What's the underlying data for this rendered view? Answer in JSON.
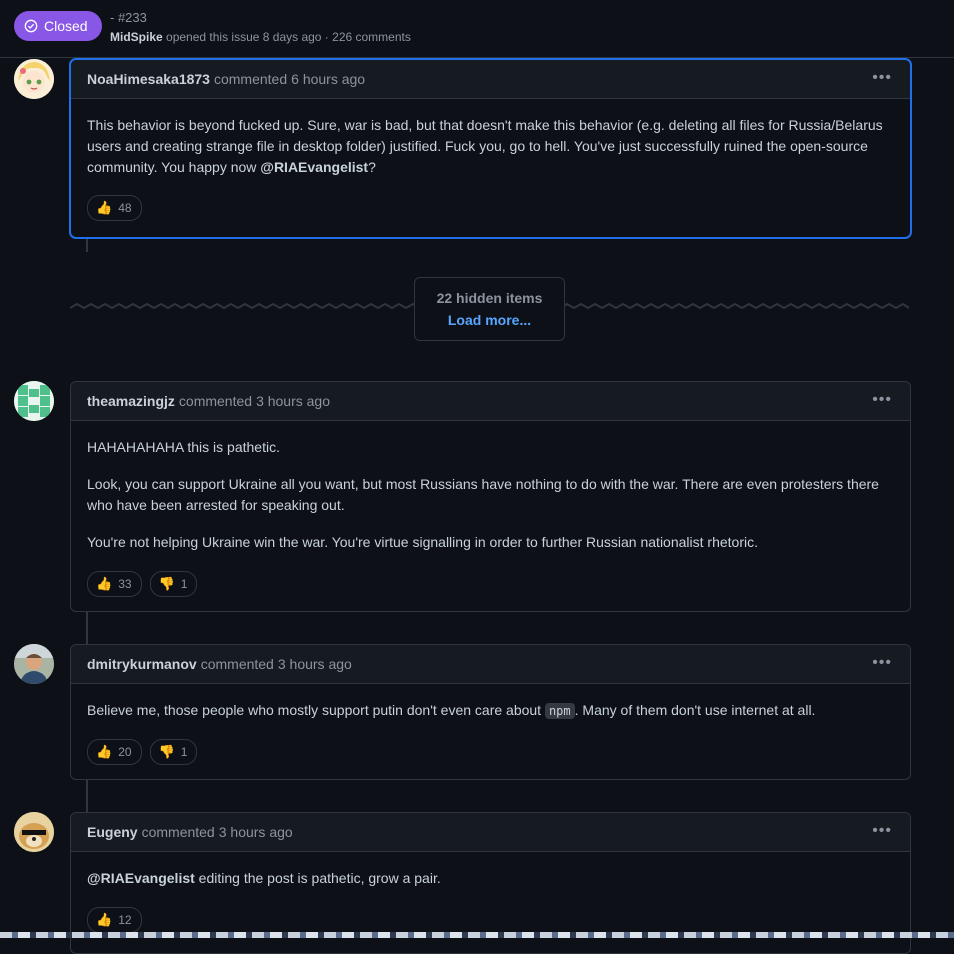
{
  "header": {
    "status_label": "Closed",
    "issue_number": "- #233",
    "author": "MidSpike",
    "meta_text": "opened this issue 8 days ago · 226 comments"
  },
  "comments": [
    {
      "author": "NoaHimesaka1873",
      "verb": "commented",
      "time": "6 hours ago",
      "body_p1": "This behavior is beyond fucked up. Sure, war is bad, but that doesn't make this behavior (e.g. deleting all files for Russia/Belarus users and creating strange file in desktop folder) justified. Fuck you, go to hell. You've just successfully ruined the open-source community. You happy now ",
      "mention": "@RIAEvangelist",
      "body_p1_end": "?",
      "reactions": [
        {
          "icon": "thumbs-up",
          "count": "48"
        }
      ]
    },
    {
      "author": "theamazingjz",
      "verb": "commented",
      "time": "3 hours ago",
      "body_p1": "HAHAHAHAHA this is pathetic.",
      "body_p2": "Look, you can support Ukraine all you want, but most Russians have nothing to do with the war. There are even protesters there who have been arrested for speaking out.",
      "body_p3": "You're not helping Ukraine win the war. You're virtue signalling in order to further Russian nationalist rhetoric.",
      "reactions": [
        {
          "icon": "thumbs-up",
          "count": "33"
        },
        {
          "icon": "thumbs-down",
          "count": "1"
        }
      ]
    },
    {
      "author": "dmitrykurmanov",
      "verb": "commented",
      "time": "3 hours ago",
      "body_pre": "Believe me, those people who mostly support putin don't even care about ",
      "code": "npm",
      "body_post": ". Many of them don't use internet at all.",
      "reactions": [
        {
          "icon": "thumbs-up",
          "count": "20"
        },
        {
          "icon": "thumbs-down",
          "count": "1"
        }
      ]
    },
    {
      "author": "Eugeny",
      "verb": "commented",
      "time": "3 hours ago",
      "mention": "@RIAEvangelist",
      "body_post": " editing the post is pathetic, grow a pair.",
      "reactions": [
        {
          "icon": "thumbs-up",
          "count": "12"
        }
      ]
    }
  ],
  "hidden": {
    "count_label": "22 hidden items",
    "load_more_label": "Load more..."
  },
  "colors": {
    "background": "#0d1117",
    "closed_badge": "#8957e5",
    "active_border": "#1f6feb",
    "link": "#58a6ff"
  }
}
